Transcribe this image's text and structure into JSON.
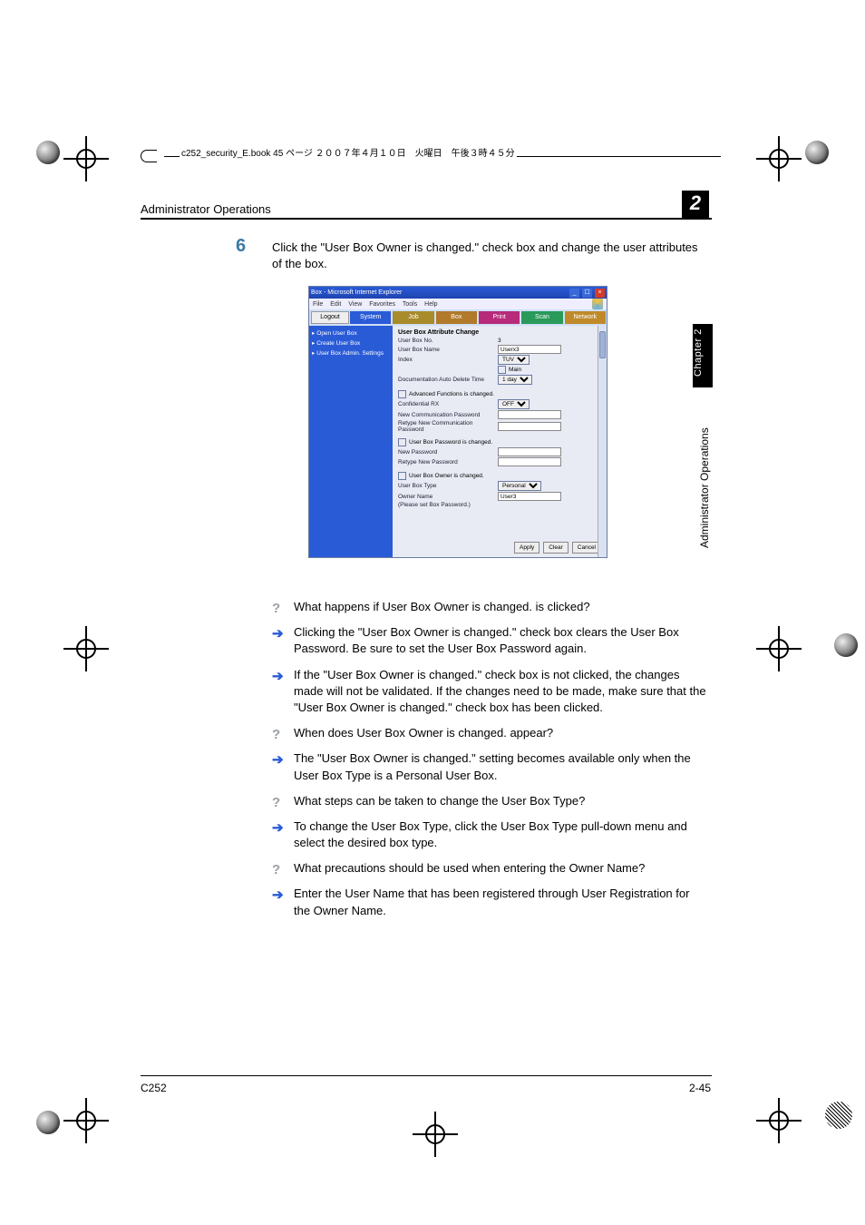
{
  "file_tag": "c252_security_E.book  45 ページ  ２００７年４月１０日　火曜日　午後３時４５分",
  "header_title": "Administrator Operations",
  "chapter_number": "2",
  "side_tab": "Chapter 2",
  "side_text": "Administrator Operations",
  "step": {
    "num": "6",
    "text": "Click the \"User Box Owner is changed.\" check box and change the user attributes of the box."
  },
  "screenshot": {
    "window_title": "Box - Microsoft Internet Explorer",
    "menu": [
      "File",
      "Edit",
      "View",
      "Favorites",
      "Tools",
      "Help"
    ],
    "logout": "Logout",
    "tabs": {
      "system": "System",
      "job": "Job",
      "box": "Box",
      "print": "Print",
      "scan": "Scan",
      "network": "Network"
    },
    "side_items": [
      "Open User Box",
      "Create User Box",
      "User Box Admin. Settings"
    ],
    "panel_title": "User Box Attribute Change",
    "fields": {
      "box_no_label": "User Box No.",
      "box_no_val": "3",
      "box_name_label": "User Box Name",
      "box_name_val": "Userx3",
      "index_label": "Index",
      "index_val": "TUV",
      "main_label": "Main",
      "auto_del_label": "Documentation Auto Delete Time",
      "auto_del_val": "1 day",
      "adv_cb": "Advanced Functions is changed.",
      "conf_rx_label": "Confidential RX",
      "conf_rx_val": "OFF",
      "new_comm_pw_label": "New Communication Password",
      "retype_comm_pw_label": "Retype New Communication Password",
      "pw_cb": "User Box Password is changed.",
      "new_pw_label": "New Password",
      "retype_pw_label": "Retype New Password",
      "owner_cb": "User Box Owner is changed.",
      "box_type_label": "User Box Type",
      "box_type_val": "Personal",
      "owner_name_label": "Owner Name",
      "owner_name_val": "User3",
      "owner_note": "(Please set Box Password.)"
    },
    "buttons": {
      "apply": "Apply",
      "clear": "Clear",
      "cancel": "Cancel"
    }
  },
  "qa": [
    {
      "type": "q",
      "text": "What happens if User Box Owner is changed. is clicked?"
    },
    {
      "type": "a",
      "text": "Clicking the \"User Box Owner is changed.\" check box clears the User Box Password. Be sure to set the User Box Password again."
    },
    {
      "type": "a",
      "text": "If the \"User Box Owner is changed.\" check box is not clicked, the changes made will not be validated. If the changes need to be made, make sure that the \"User Box Owner is changed.\" check box has been clicked."
    },
    {
      "type": "q",
      "text": "When does User Box Owner is changed. appear?"
    },
    {
      "type": "a",
      "text": "The \"User Box Owner is changed.\" setting becomes available only when the User Box Type is a Personal User Box."
    },
    {
      "type": "q",
      "text": "What steps can be taken to change the User Box Type?"
    },
    {
      "type": "a",
      "text": "To change the User Box Type, click the User Box Type pull-down menu and select the desired box type."
    },
    {
      "type": "q",
      "text": "What precautions should be used when entering the Owner Name?"
    },
    {
      "type": "a",
      "text": "Enter the User Name that has been registered through User Registration for the Owner Name."
    }
  ],
  "footer": {
    "left": "C252",
    "right": "2-45"
  }
}
